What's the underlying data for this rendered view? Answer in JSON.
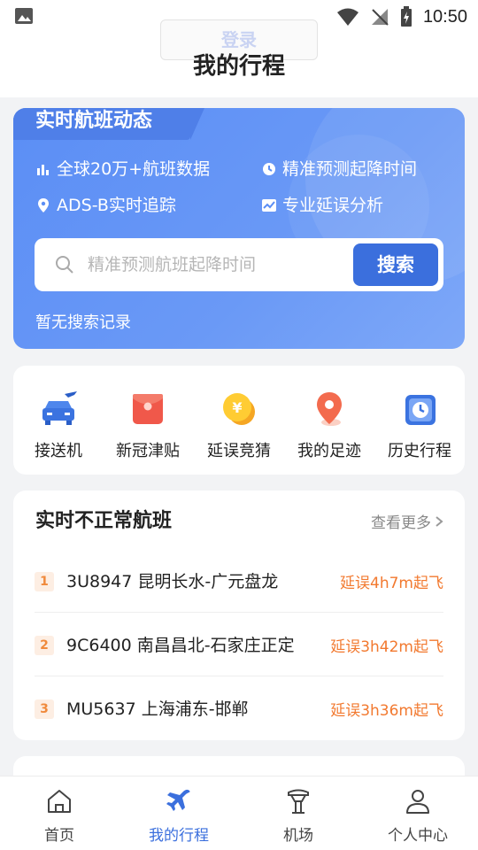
{
  "status_bar": {
    "time": "10:50"
  },
  "header": {
    "login_label": "登录",
    "title": "我的行程"
  },
  "flight_search": {
    "title": "实时航班动态",
    "features": [
      "全球20万+航班数据",
      "精准预测起降时间",
      "ADS-B实时追踪",
      "专业延误分析"
    ],
    "search_placeholder": "精准预测航班起降时间",
    "search_button": "搜索",
    "no_history": "暂无搜索记录"
  },
  "quick_actions": [
    {
      "label": "接送机",
      "icon": "car-plane-icon"
    },
    {
      "label": "新冠津贴",
      "icon": "red-envelope-icon"
    },
    {
      "label": "延误竞猜",
      "icon": "yen-coin-icon"
    },
    {
      "label": "我的足迹",
      "icon": "location-pin-icon"
    },
    {
      "label": "历史行程",
      "icon": "clock-icon"
    }
  ],
  "abnormal_flights": {
    "title": "实时不正常航班",
    "more": "查看更多",
    "rows": [
      {
        "rank": "1",
        "route": "3U8947 昆明长水-广元盘龙",
        "delay": "延误4h7m起飞"
      },
      {
        "rank": "2",
        "route": "9C6400 南昌昌北-石家庄正定",
        "delay": "延误3h42m起飞"
      },
      {
        "rank": "3",
        "route": "MU5637 上海浦东-邯郸",
        "delay": "延误3h36m起飞"
      }
    ]
  },
  "tabbar": [
    {
      "label": "首页",
      "icon": "home-icon",
      "active": false
    },
    {
      "label": "我的行程",
      "icon": "airplane-icon",
      "active": true
    },
    {
      "label": "机场",
      "icon": "airport-tower-icon",
      "active": false
    },
    {
      "label": "个人中心",
      "icon": "user-icon",
      "active": false
    }
  ],
  "colors": {
    "accent": "#3b6fdd",
    "card_blue": "#5b8ef5",
    "delay_orange": "#f2792f",
    "background": "#f2f3f5"
  }
}
